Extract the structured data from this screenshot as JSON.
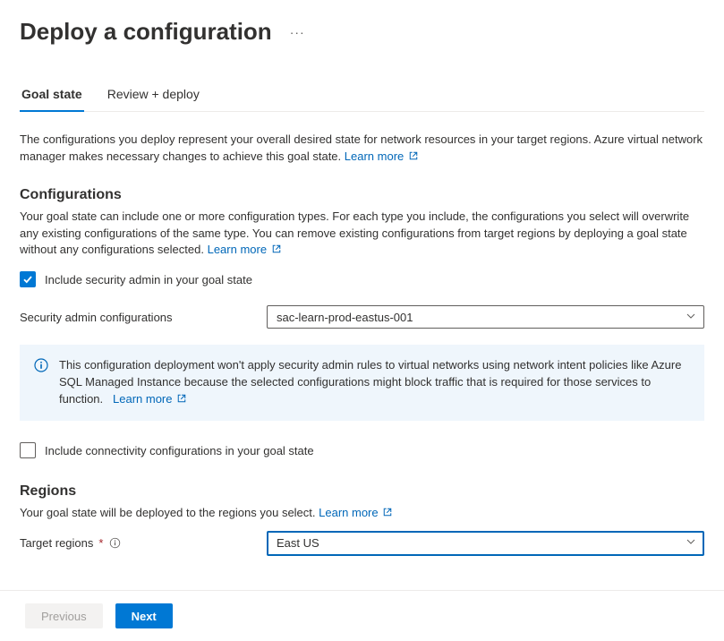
{
  "header": {
    "title": "Deploy a configuration"
  },
  "tabs": {
    "goal_state": "Goal state",
    "review_deploy": "Review + deploy"
  },
  "intro": {
    "text": "The configurations you deploy represent your overall desired state for network resources in your target regions. Azure virtual network manager makes necessary changes to achieve this goal state.",
    "learn_more": "Learn more"
  },
  "configurations": {
    "heading": "Configurations",
    "desc": "Your goal state can include one or more configuration types. For each type you include, the configurations you select will overwrite any existing configurations of the same type. You can remove existing configurations from target regions by deploying a goal state without any configurations selected.",
    "learn_more": "Learn more",
    "include_security_label": "Include security admin in your goal state",
    "security_admin_label": "Security admin configurations",
    "security_admin_value": "sac-learn-prod-eastus-001",
    "info_text": "This configuration deployment won't apply security admin rules to virtual networks using network intent policies like Azure SQL Managed Instance because the selected configurations might block traffic that is required for those services to function.",
    "info_learn_more": "Learn more",
    "include_connectivity_label": "Include connectivity configurations in your goal state"
  },
  "regions": {
    "heading": "Regions",
    "desc": "Your goal state will be deployed to the regions you select.",
    "learn_more": "Learn more",
    "target_regions_label": "Target regions",
    "target_regions_value": "East US"
  },
  "footer": {
    "previous": "Previous",
    "next": "Next"
  }
}
